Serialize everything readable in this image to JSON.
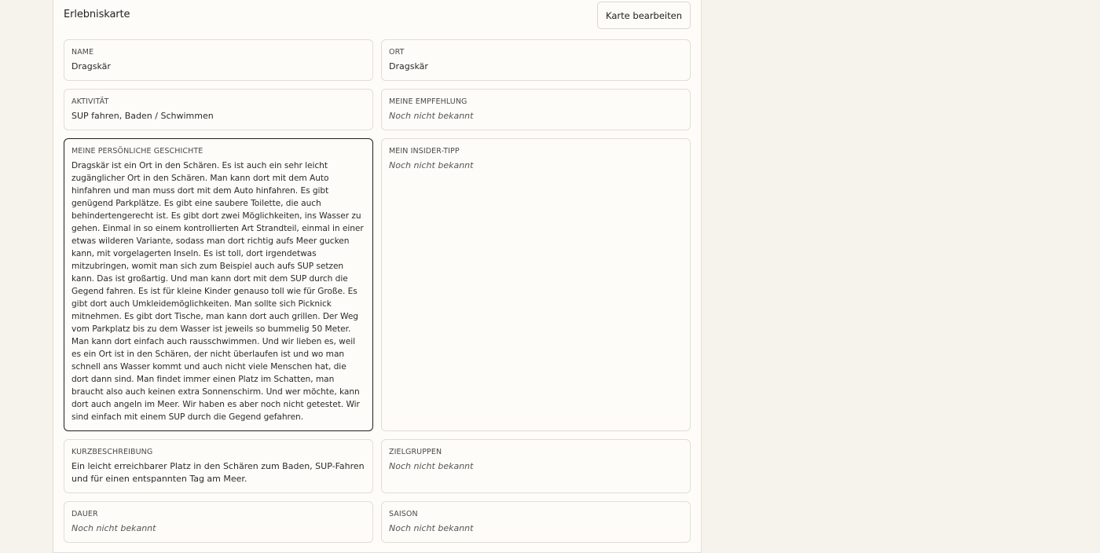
{
  "card": {
    "title": "Erlebniskarte",
    "edit_label": "Karte bearbeiten"
  },
  "fields": {
    "name": {
      "label": "NAME",
      "value": "Dragskär"
    },
    "ort": {
      "label": "ORT",
      "value": "Dragskär"
    },
    "aktivitaet": {
      "label": "AKTIVITÄT",
      "value": "SUP fahren, Baden / Schwimmen"
    },
    "empfehlung": {
      "label": "MEINE EMPFEHLUNG",
      "value": "Noch nicht bekannt"
    },
    "geschichte": {
      "label": "MEINE PERSÖNLICHE GESCHICHTE",
      "value": "Dragskär ist ein Ort in den Schären. Es ist auch ein sehr leicht zugänglicher Ort in den Schären. Man kann dort mit dem Auto hinfahren und man muss dort mit dem Auto hinfahren. Es gibt genügend Parkplätze. Es gibt eine saubere Toilette, die auch behindertengerecht ist. Es gibt dort zwei Möglichkeiten, ins Wasser zu gehen. Einmal in so einem kontrollierten Art Strandteil, einmal in einer etwas wilderen Variante, sodass man dort richtig aufs Meer gucken kann, mit vorgelagerten Inseln. Es ist toll, dort irgendetwas mitzubringen, womit man sich zum Beispiel auch aufs SUP setzen kann. Das ist großartig. Und man kann dort mit dem SUP durch die Gegend fahren. Es ist für kleine Kinder genauso toll wie für Große. Es gibt dort auch Umkleidemöglichkeiten. Man sollte sich Picknick mitnehmen. Es gibt dort Tische, man kann dort auch grillen. Der Weg vom Parkplatz bis zu dem Wasser ist jeweils so bummelig 50 Meter. Man kann dort einfach auch rausschwimmen. Und wir lieben es, weil es ein Ort ist in den Schären, der nicht überlaufen ist und wo man schnell ans Wasser kommt und auch nicht viele Menschen hat, die dort dann sind. Man findet immer einen Platz im Schatten, man braucht also auch keinen extra Sonnenschirm. Und wer möchte, kann dort auch angeln im Meer. Wir haben es aber noch nicht getestet. Wir sind einfach mit einem SUP durch die Gegend gefahren."
    },
    "insider": {
      "label": "MEIN INSIDER-TIPP",
      "value": "Noch nicht bekannt"
    },
    "kurz": {
      "label": "KURZBESCHREIBUNG",
      "value": "Ein leicht erreichbarer Platz in den Schären zum Baden, SUP-Fahren und für einen entspannten Tag am Meer."
    },
    "zielgruppen": {
      "label": "ZIELGRUPPEN",
      "value": "Noch nicht bekannt"
    },
    "dauer": {
      "label": "DAUER",
      "value": "Noch nicht bekannt"
    },
    "saison": {
      "label": "SAISON",
      "value": "Noch nicht bekannt"
    }
  }
}
